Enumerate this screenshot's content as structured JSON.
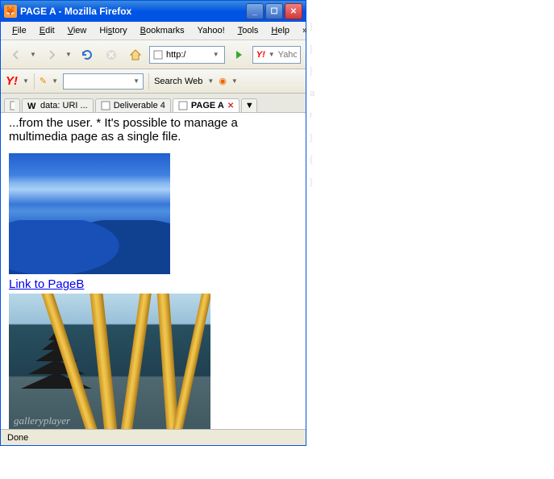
{
  "window": {
    "title": "PAGE A - Mozilla Firefox"
  },
  "menu": {
    "file": "File",
    "edit": "Edit",
    "view": "View",
    "history": "History",
    "bookmarks": "Bookmarks",
    "yahoo": "Yahoo!",
    "tools": "Tools",
    "help": "Help",
    "chev": "»"
  },
  "toolbar": {
    "url": "http:/",
    "search_placeholder": "Yahoo"
  },
  "yahoo": {
    "logo": "Y!",
    "searchweb": "Search Web"
  },
  "tabs": {
    "t1": "data: URI ...",
    "t2": "Deliverable 4",
    "t3": "PAGE A"
  },
  "page": {
    "text": "...from the user. * It's possible to manage a multimedia page as a single file.",
    "link": "Link to PageB",
    "watermark": "galleryplayer"
  },
  "status": {
    "text": "Done"
  }
}
